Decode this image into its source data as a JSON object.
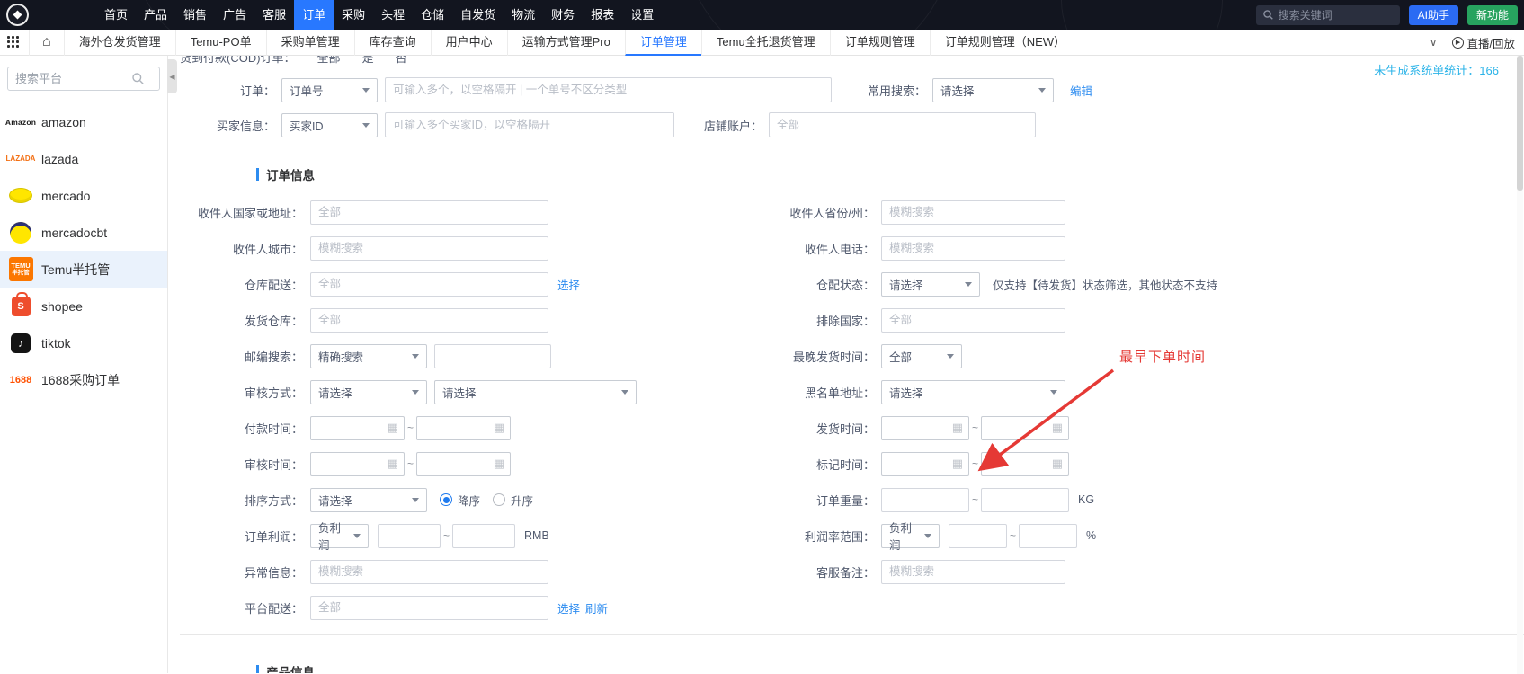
{
  "topnav": {
    "items": [
      "首页",
      "产品",
      "销售",
      "广告",
      "客服",
      "订单",
      "采购",
      "头程",
      "仓储",
      "自发货",
      "物流",
      "财务",
      "报表",
      "设置"
    ],
    "active": "订单",
    "search_placeholder": "搜索关键词",
    "ai_assistant": "AI助手",
    "new_feature": "新功能"
  },
  "tabbar": {
    "tabs": [
      "海外仓发货管理",
      "Temu-PO单",
      "采购单管理",
      "库存查询",
      "用户中心",
      "运输方式管理Pro",
      "订单管理",
      "Temu全托退货管理",
      "订单规则管理",
      "订单规则管理（NEW）"
    ],
    "active": "订单管理",
    "live": "直播/回放"
  },
  "sidebar": {
    "search_placeholder": "搜索平台",
    "platforms": [
      {
        "name": "amazon",
        "icon": "amazon-logo"
      },
      {
        "name": "lazada",
        "icon": "lazada-logo"
      },
      {
        "name": "mercado",
        "icon": "mercado-logo"
      },
      {
        "name": "mercadocbt",
        "icon": "mercadocbt-logo"
      },
      {
        "name": "Temu半托管",
        "icon": "temu-logo"
      },
      {
        "name": "shopee",
        "icon": "shopee-logo"
      },
      {
        "name": "tiktok",
        "icon": "tiktok-logo"
      },
      {
        "name": "1688采购订单",
        "icon": "1688-logo"
      }
    ],
    "active": "Temu半托管"
  },
  "stats": {
    "label": "未生成系统单统计：",
    "value": "166"
  },
  "filters": {
    "tilde": "~",
    "cod": {
      "label": "货到付款(COD)订单：",
      "options": [
        "全部",
        "是",
        "否"
      ]
    },
    "order": {
      "label": "订单：",
      "type": "订单号",
      "placeholder": "可输入多个，以空格隔开 | 一个单号不区分类型"
    },
    "quick_search": {
      "label": "常用搜索：",
      "value": "请选择",
      "edit_link": "编辑"
    },
    "buyer": {
      "label": "买家信息：",
      "type": "买家ID",
      "placeholder": "可输入多个买家ID，以空格隔开"
    },
    "shop_account": {
      "label": "店铺账户：",
      "placeholder": "全部"
    },
    "order_section_title": "订单信息",
    "product_section_title": "产品信息",
    "recipient_country": {
      "label": "收件人国家或地址：",
      "placeholder": "全部"
    },
    "recipient_state": {
      "label": "收件人省份/州：",
      "placeholder": "模糊搜索"
    },
    "recipient_city": {
      "label": "收件人城市：",
      "placeholder": "模糊搜索"
    },
    "recipient_phone": {
      "label": "收件人电话：",
      "placeholder": "模糊搜索"
    },
    "warehouse_delivery": {
      "label": "仓库配送：",
      "placeholder": "全部",
      "select_link": "选择"
    },
    "warehouse_status": {
      "label": "仓配状态：",
      "value": "请选择",
      "note": "仅支持【待发货】状态筛选，其他状态不支持"
    },
    "ship_warehouse": {
      "label": "发货仓库：",
      "placeholder": "全部"
    },
    "exclude_country": {
      "label": "排除国家：",
      "placeholder": "全部"
    },
    "zip_search": {
      "label": "邮编搜索：",
      "mode": "精确搜索"
    },
    "latest_ship_time": {
      "label": "最晚发货时间：",
      "value": "全部"
    },
    "review_method": {
      "label": "审核方式：",
      "value": "请选择",
      "value2": "请选择"
    },
    "blacklist_address": {
      "label": "黑名单地址：",
      "value": "请选择"
    },
    "pay_time": {
      "label": "付款时间："
    },
    "ship_time": {
      "label": "发货时间："
    },
    "review_time": {
      "label": "审核时间："
    },
    "mark_time": {
      "label": "标记时间："
    },
    "sort": {
      "label": "排序方式：",
      "value": "请选择",
      "desc": "降序",
      "asc": "升序"
    },
    "order_weight": {
      "label": "订单重量：",
      "unit": "KG"
    },
    "order_profit": {
      "label": "订单利润：",
      "mode": "负利润",
      "unit": "RMB"
    },
    "profit_rate": {
      "label": "利润率范围：",
      "mode": "负利润",
      "unit": "%"
    },
    "abnormal_info": {
      "label": "异常信息：",
      "placeholder": "模糊搜索"
    },
    "cs_note": {
      "label": "客服备注：",
      "placeholder": "模糊搜索"
    },
    "platform_delivery": {
      "label": "平台配送：",
      "placeholder": "全部",
      "select_link": "选择",
      "refresh_link": "刷新"
    }
  },
  "annotation": {
    "text": "最早下单时间"
  },
  "colors": {
    "accent": "#2878ff",
    "green": "#27a35f",
    "link": "#2d8cf0",
    "stat": "#2bb3e8",
    "annotation_red": "#e53935",
    "temu": "#fb7701",
    "shopee": "#ee4d2d",
    "brand_1688": "#ff5000"
  }
}
